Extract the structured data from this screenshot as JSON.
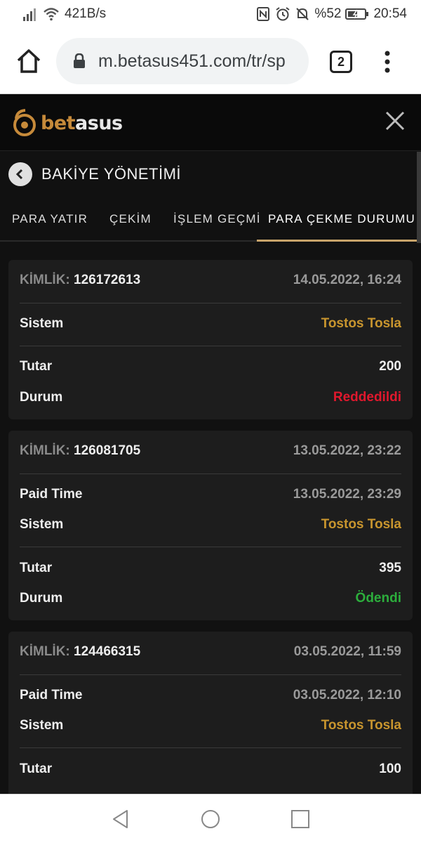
{
  "status_bar": {
    "speed": "421B/s",
    "battery": "%52",
    "time": "20:54"
  },
  "browser": {
    "url": "m.betasus451.com/tr/sp",
    "tab_count": "2"
  },
  "app": {
    "logo_bet": "bet",
    "logo_sus": "asus",
    "title": "BAKİYE YÖNETİMİ"
  },
  "tabs": [
    {
      "label": "PARA YATIR",
      "active": false
    },
    {
      "label": "ÇEKİM",
      "active": false
    },
    {
      "label": "İŞLEM GEÇMİ",
      "active": false
    },
    {
      "label": "PARA ÇEKME DURUMU",
      "active": true
    }
  ],
  "cards": [
    {
      "id_label": "KİMLİK:",
      "id": "126172613",
      "date": "14.05.2022, 16:24",
      "system_label": "Sistem",
      "system": "Tostos Tosla",
      "amount_label": "Tutar",
      "amount": "200",
      "status_label": "Durum",
      "status": "Reddedildi"
    },
    {
      "id_label": "KİMLİK:",
      "id": "126081705",
      "date": "13.05.2022, 23:22",
      "paid_label": "Paid Time",
      "paid_time": "13.05.2022, 23:29",
      "system_label": "Sistem",
      "system": "Tostos Tosla",
      "amount_label": "Tutar",
      "amount": "395",
      "status_label": "Durum",
      "status": "Ödendi"
    },
    {
      "id_label": "KİMLİK:",
      "id": "124466315",
      "date": "03.05.2022, 11:59",
      "paid_label": "Paid Time",
      "paid_time": "03.05.2022, 12:10",
      "system_label": "Sistem",
      "system": "Tostos Tosla",
      "amount_label": "Tutar",
      "amount": "100"
    }
  ],
  "colors": {
    "accent_gold": "#c8952e",
    "status_rejected": "#e0182d",
    "status_paid": "#2cae3c"
  }
}
